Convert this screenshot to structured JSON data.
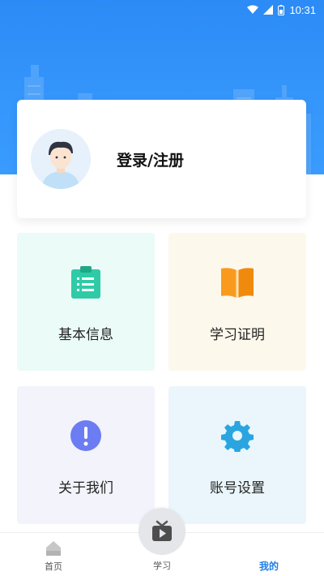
{
  "status_bar": {
    "time": "10:31"
  },
  "login": {
    "label": "登录/注册"
  },
  "tiles": [
    {
      "label": "基本信息",
      "icon": "clipboard-icon",
      "color": "#2fcba6"
    },
    {
      "label": "学习证明",
      "icon": "book-icon",
      "color": "#f99a1c"
    },
    {
      "label": "关于我们",
      "icon": "info-exclamation-icon",
      "color": "#6c7cf2"
    },
    {
      "label": "账号设置",
      "icon": "gear-icon",
      "color": "#2aa5e0"
    }
  ],
  "nav": {
    "home": "首页",
    "study": "学习",
    "mine": "我的",
    "active_color": "#1f7fe8"
  },
  "colors": {
    "header_blue": "#3596fb"
  }
}
